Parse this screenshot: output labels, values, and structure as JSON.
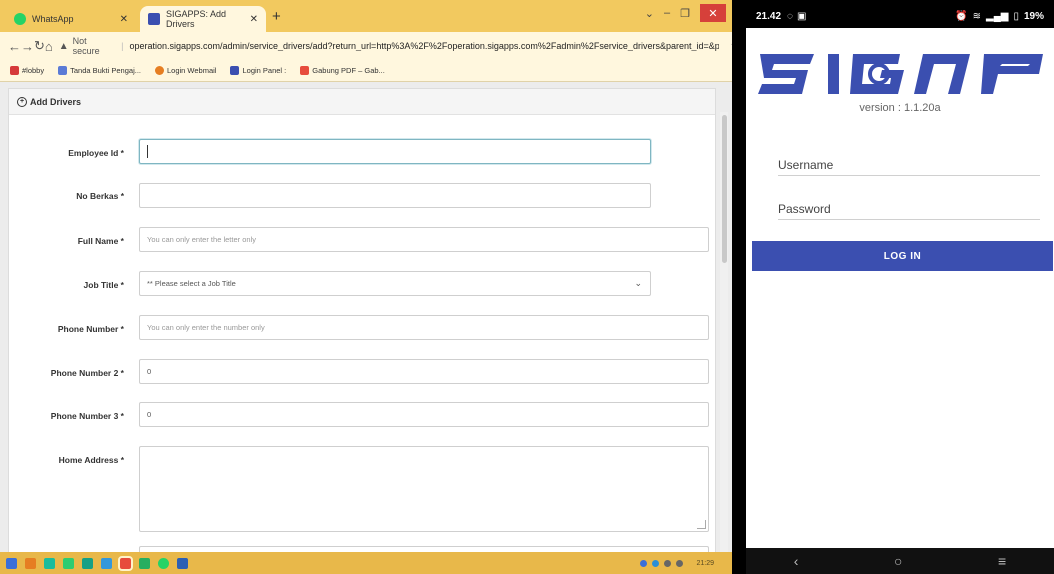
{
  "browser": {
    "tabs": [
      {
        "label": "WhatsApp",
        "active": false,
        "icon_color": "#25d366"
      },
      {
        "label": "SIGAPPS: Add Drivers",
        "active": true,
        "icon_color": "#3b4fb0"
      }
    ],
    "new_tab": "+",
    "address": {
      "security": "Not secure",
      "url": "operation.sigapps.com/admin/service_drivers/add?return_url=http%3A%2F%2Foperation.sigapps.com%2Fadmin%2Fservice_drivers&parent_id=&par..."
    },
    "bookmarks": [
      {
        "label": "#lobby",
        "color": "#d63a3a"
      },
      {
        "label": "Tanda Bukti Pengaj...",
        "color": "#5b7bd6"
      },
      {
        "label": "Login Webmail",
        "color": "#e67e22"
      },
      {
        "label": "Login Panel :",
        "color": "#3b4fb0"
      },
      {
        "label": "Gabung PDF – Gab...",
        "color": "#e74c3c"
      }
    ]
  },
  "form": {
    "title": "Add Drivers",
    "fields": [
      {
        "label": "Employee Id *",
        "placeholder": "",
        "value": ""
      },
      {
        "label": "No Berkas *",
        "placeholder": "",
        "value": ""
      },
      {
        "label": "Full Name *",
        "placeholder": "You can only enter the letter only",
        "value": ""
      },
      {
        "label": "Job Title *",
        "placeholder": "** Please select a Job Title",
        "value": ""
      },
      {
        "label": "Phone Number *",
        "placeholder": "You can only enter the number only",
        "value": ""
      },
      {
        "label": "Phone Number 2 *",
        "placeholder": "",
        "value": "0"
      },
      {
        "label": "Phone Number 3 *",
        "placeholder": "",
        "value": "0"
      },
      {
        "label": "Home Address *",
        "placeholder": "",
        "value": ""
      }
    ]
  },
  "taskbar": {
    "clock": "21:29",
    "apps": [
      "#3a6fd8",
      "#e67e22",
      "#1abc9c",
      "#2ecc71",
      "#16a085",
      "#3498db",
      "#e74c3c",
      "#27ae60",
      "#25d366",
      "#2c5fb3"
    ]
  },
  "phone": {
    "status": {
      "time": "21.42",
      "battery": "19%"
    },
    "logo": "SIGAP",
    "version": "version : 1.1.20a",
    "username_label": "Username",
    "password_label": "Password",
    "login_label": "LOG IN",
    "brand_color": "#3b4fb0"
  }
}
